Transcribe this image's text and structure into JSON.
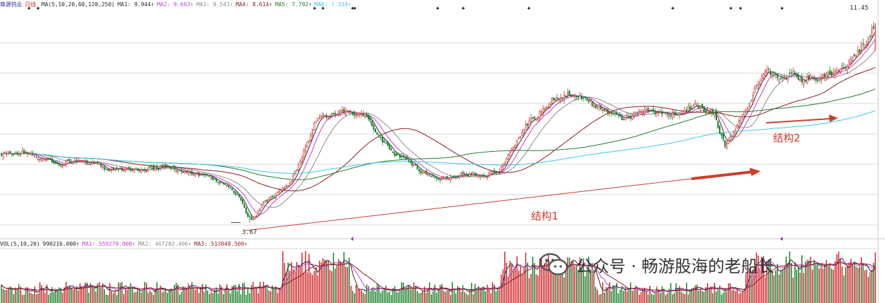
{
  "colors": {
    "up": "#d0262a",
    "down": "#1a7f2e",
    "ma1": "#2b2b2b",
    "ma2": "#c23fc9",
    "ma3": "#8c8c8c",
    "ma4": "#8b1a1a",
    "ma5": "#1f7a2c",
    "ma6": "#38c9e6",
    "arrow": "#cf3b2c",
    "grid": "#d9d9d9",
    "header_text": "#3d3d9e"
  },
  "header": {
    "stock_name": "章源钨业",
    "period": "日线",
    "ma_params": "MA(5,10,20,60,120,250)",
    "ma1": "MA1: 9.944↑",
    "ma2": "MA2: 9.663↑",
    "ma3": "MA3: 9.543↑",
    "ma4": "MA4: 8.614↑",
    "ma5": "MA5: 7.792↑",
    "ma6": "MA6: 7.334↑"
  },
  "volume_header": {
    "params": "VOL(5,10,20)",
    "vol": "990216.000↑",
    "ma1": "MA1: 559270.000↑",
    "ma2": "MA2: 467282.406↑",
    "ma3": "MA3: 513048.500↑"
  },
  "annotations": {
    "high": "11.45",
    "low": "3.67",
    "structure1": "结构1",
    "structure2": "结构2"
  },
  "watermark": {
    "text": "公众号 · 畅游股海的老船长",
    "icon": "wechat-icon"
  },
  "chart_data": {
    "type": "candlestick",
    "title": "章源钨业 日线",
    "price_range": [
      3.2,
      12.0
    ],
    "grid": true,
    "price_anchors": [
      [
        0,
        6.3
      ],
      [
        12,
        6.45
      ],
      [
        30,
        6.0
      ],
      [
        45,
        6.05
      ],
      [
        60,
        5.8
      ],
      [
        80,
        5.75
      ],
      [
        95,
        5.85
      ],
      [
        110,
        5.6
      ],
      [
        125,
        5.3
      ],
      [
        135,
        4.8
      ],
      [
        142,
        3.67
      ],
      [
        150,
        4.4
      ],
      [
        165,
        5.2
      ],
      [
        180,
        7.6
      ],
      [
        195,
        8.0
      ],
      [
        208,
        7.9
      ],
      [
        218,
        6.8
      ],
      [
        235,
        5.9
      ],
      [
        250,
        5.4
      ],
      [
        265,
        5.5
      ],
      [
        285,
        5.7
      ],
      [
        300,
        7.5
      ],
      [
        315,
        8.4
      ],
      [
        328,
        8.8
      ],
      [
        340,
        8.2
      ],
      [
        355,
        7.8
      ],
      [
        370,
        8.0
      ],
      [
        385,
        7.9
      ],
      [
        398,
        8.3
      ],
      [
        408,
        7.9
      ],
      [
        414,
        6.6
      ],
      [
        425,
        7.9
      ],
      [
        435,
        9.5
      ],
      [
        448,
        9.4
      ],
      [
        460,
        9.3
      ],
      [
        475,
        9.5
      ],
      [
        485,
        9.9
      ],
      [
        494,
        10.7
      ],
      [
        500,
        11.45
      ]
    ],
    "ma_periods": [
      5,
      10,
      20,
      60,
      120,
      250
    ],
    "volume": {
      "params": [
        5,
        10,
        20
      ],
      "last": 990216,
      "ma": [
        559270,
        467282.406,
        513048.5
      ]
    },
    "annotations": [
      {
        "text": "结构1",
        "type": "arrow"
      },
      {
        "text": "结构2",
        "type": "arrow"
      },
      {
        "text": "3.67",
        "type": "low"
      },
      {
        "text": "11.45",
        "type": "high"
      }
    ]
  }
}
